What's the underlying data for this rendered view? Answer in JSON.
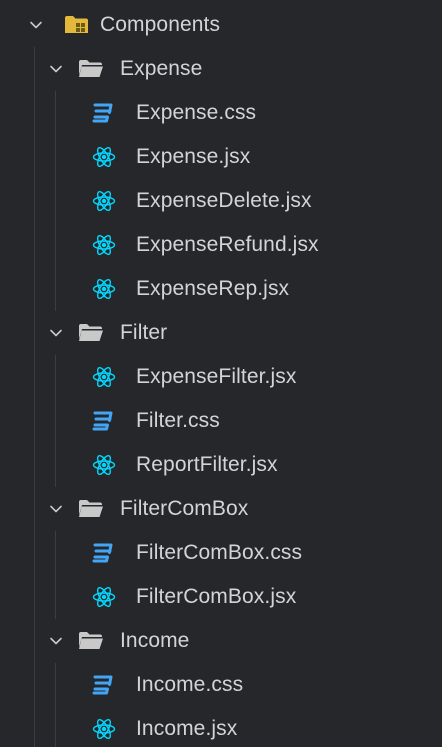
{
  "explorer": {
    "root": {
      "label": "Components",
      "icon": "folder-components-icon",
      "expanded": true
    },
    "folders": [
      {
        "label": "Expense",
        "expanded": true,
        "files": [
          {
            "label": "Expense.css",
            "type": "css"
          },
          {
            "label": "Expense.jsx",
            "type": "react"
          },
          {
            "label": "ExpenseDelete.jsx",
            "type": "react"
          },
          {
            "label": "ExpenseRefund.jsx",
            "type": "react"
          },
          {
            "label": "ExpenseRep.jsx",
            "type": "react"
          }
        ]
      },
      {
        "label": "Filter",
        "expanded": true,
        "files": [
          {
            "label": "ExpenseFilter.jsx",
            "type": "react"
          },
          {
            "label": "Filter.css",
            "type": "css"
          },
          {
            "label": "ReportFilter.jsx",
            "type": "react"
          }
        ]
      },
      {
        "label": "FilterComBox",
        "expanded": true,
        "files": [
          {
            "label": "FilterComBox.css",
            "type": "css"
          },
          {
            "label": "FilterComBox.jsx",
            "type": "react"
          }
        ]
      },
      {
        "label": "Income",
        "expanded": true,
        "files": [
          {
            "label": "Income.css",
            "type": "css"
          },
          {
            "label": "Income.jsx",
            "type": "react"
          }
        ]
      }
    ],
    "colors": {
      "background": "#25272b",
      "text": "#d4d4d4",
      "chevron": "#c8c8c8",
      "folder": "#c9c9c9",
      "components_folder": "#e2b93b",
      "css_icon": "#42a5f5",
      "react_icon": "#00d8ff",
      "guide": "#3a3d42"
    }
  }
}
